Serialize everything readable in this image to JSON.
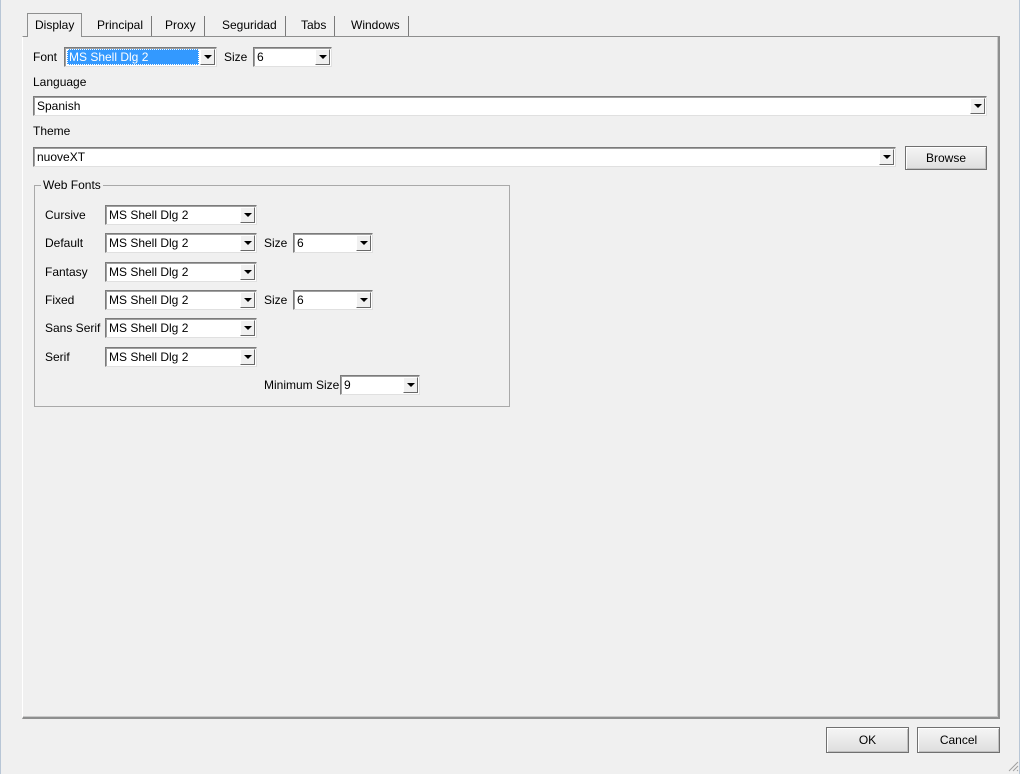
{
  "tabs": [
    {
      "label": "Display",
      "active": true
    },
    {
      "label": "Principal",
      "active": false
    },
    {
      "label": "Proxy",
      "active": false
    },
    {
      "label": "Seguridad",
      "active": false
    },
    {
      "label": "Tabs",
      "active": false
    },
    {
      "label": "Windows",
      "active": false
    }
  ],
  "display": {
    "font_label": "Font",
    "font_value": "MS Shell Dlg 2",
    "size_label": "Size",
    "size_value": "6",
    "language_label": "Language",
    "language_value": "Spanish",
    "theme_label": "Theme",
    "theme_value": "nuoveXT",
    "browse_label": "Browse"
  },
  "web_fonts": {
    "title": "Web Fonts",
    "cursive_label": "Cursive",
    "cursive_value": "MS Shell Dlg 2",
    "default_label": "Default",
    "default_value": "MS Shell Dlg 2",
    "default_size_label": "Size",
    "default_size_value": "6",
    "fantasy_label": "Fantasy",
    "fantasy_value": "MS Shell Dlg 2",
    "fixed_label": "Fixed",
    "fixed_value": "MS Shell Dlg 2",
    "fixed_size_label": "Size",
    "fixed_size_value": "6",
    "sans_serif_label": "Sans Serif",
    "sans_serif_value": "MS Shell Dlg 2",
    "serif_label": "Serif",
    "serif_value": "MS Shell Dlg 2",
    "minimum_size_label": "Minimum Size",
    "minimum_size_value": "9"
  },
  "footer": {
    "ok_label": "OK",
    "cancel_label": "Cancel"
  },
  "colors": {
    "selection": "#3399ff",
    "window_bg": "#f0f0f0"
  }
}
